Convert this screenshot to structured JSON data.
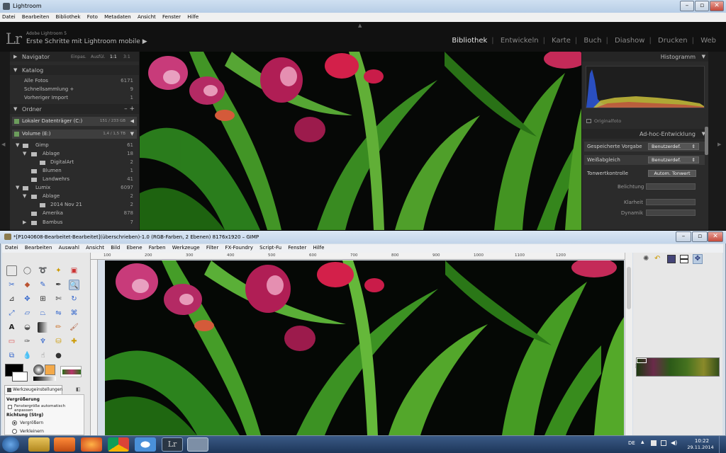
{
  "lightroom": {
    "window_title": "Lightroom",
    "menu": [
      "Datei",
      "Bearbeiten",
      "Bibliothek",
      "Foto",
      "Metadaten",
      "Ansicht",
      "Fenster",
      "Hilfe"
    ],
    "app_name": "Adobe Lightroom 5",
    "mobile_label": "Erste Schritte mit Lightroom mobile",
    "mobile_arrow": "▶",
    "modules": [
      "Bibliothek",
      "Entwickeln",
      "Karte",
      "Buch",
      "Diashow",
      "Drucken",
      "Web"
    ],
    "active_module": "Bibliothek",
    "navigator": {
      "title": "Navigator",
      "zoom_options": [
        "Einpas.",
        "Ausfül.",
        "1:1",
        "3:1"
      ]
    },
    "catalog": {
      "title": "Katalog",
      "items": [
        {
          "label": "Alle Fotos",
          "count": "6171"
        },
        {
          "label": "Schnellsammlung  +",
          "count": "9"
        },
        {
          "label": "Vorheriger Import",
          "count": "1"
        }
      ]
    },
    "folders": {
      "title": "Ordner",
      "add": "–  +",
      "volumes": [
        {
          "label": "Lokaler Datenträger (C:)",
          "info": "151 / 233 GB"
        },
        {
          "label": "Volume (E:)",
          "info": "1,4 / 1,5 TB"
        }
      ],
      "tree": [
        {
          "label": "Gimp",
          "count": "61",
          "level": 0
        },
        {
          "label": "Ablage",
          "count": "18",
          "level": 1
        },
        {
          "label": "DigitalArt",
          "count": "2",
          "level": 2
        },
        {
          "label": "Blumen",
          "count": "1",
          "level": 1
        },
        {
          "label": "Landwehrs",
          "count": "41",
          "level": 1
        },
        {
          "label": "Lumix",
          "count": "6097",
          "level": 0
        },
        {
          "label": "Ablage",
          "count": "2",
          "level": 1
        },
        {
          "label": "2014 Nov 21",
          "count": "2",
          "level": 2
        },
        {
          "label": "Amerika",
          "count": "878",
          "level": 1
        },
        {
          "label": "Bambus",
          "count": "7",
          "level": 1
        }
      ]
    },
    "histogram": {
      "title": "Histogramm",
      "original": "Originalfoto"
    },
    "quick_develop": {
      "title": "Ad-hoc-Entwicklung",
      "saved_preset": {
        "label": "Gespeicherte Vorgabe",
        "value": "Benutzerdef."
      },
      "white_balance": {
        "label": "Weißabgleich",
        "value": "Benutzerdef."
      },
      "tone": {
        "label": "Tonwertkontrolle",
        "button": "Autom. Tonwert"
      },
      "sliders": [
        "Belichtung",
        "Klarheit",
        "Dynamik"
      ]
    }
  },
  "gimp": {
    "window_title": "*[P1040608-Bearbeitet-Bearbeitet](überschrieben)-1.0 (RGB-Farben, 2 Ebenen) 8176x1920 – GIMP",
    "menu": [
      "Datei",
      "Bearbeiten",
      "Auswahl",
      "Ansicht",
      "Bild",
      "Ebene",
      "Farben",
      "Werkzeuge",
      "Filter",
      "FX-Foundry",
      "Script-Fu",
      "Fenster",
      "Hilfe"
    ],
    "ruler_ticks": [
      "100",
      "200",
      "300",
      "400",
      "500",
      "600",
      "700",
      "800",
      "900",
      "1000",
      "1100",
      "1200"
    ],
    "tool_options": {
      "tab": "Werkzeugeinstellungen",
      "title": "Vergrößerung",
      "auto_resize": "Fenstergröße automatisch anpassen",
      "direction": "Richtung (Strg)",
      "zoom_in": "Vergrößern",
      "zoom_out": "Verkleinern"
    }
  },
  "taskbar": {
    "language": "DE",
    "time": "10:22",
    "date": "29.11.2014",
    "lr_label": "Lr"
  }
}
